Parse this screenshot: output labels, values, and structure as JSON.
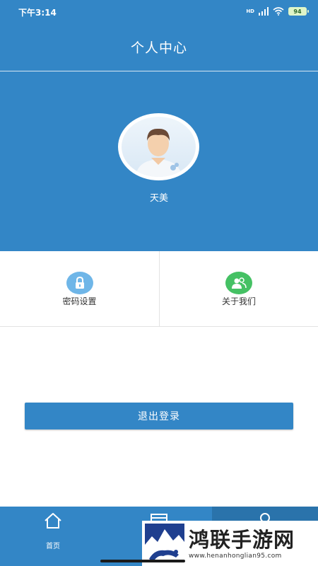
{
  "status_bar": {
    "time": "下午3:14",
    "network": "HD",
    "battery": "94"
  },
  "header": {
    "title": "个人中心"
  },
  "profile": {
    "username": "天美"
  },
  "menu": [
    {
      "label": "密码设置",
      "icon": "lock-icon",
      "color": "#6fb6e8"
    },
    {
      "label": "关于我们",
      "icon": "users-icon",
      "color": "#45c164"
    }
  ],
  "logout": {
    "label": "退出登录"
  },
  "tabbar": {
    "items": [
      {
        "label": "首页",
        "icon": "home-icon",
        "active": false
      },
      {
        "label": "",
        "icon": "calendar-icon",
        "active": false
      },
      {
        "label": "",
        "icon": "person-icon",
        "active": true
      }
    ]
  },
  "watermark": {
    "title": "鸿联手游网",
    "url": "www.henanhonglian95.com"
  },
  "colors": {
    "primary": "#3386c6",
    "active_tab": "#2a73ab",
    "menu_blue": "#6fb6e8",
    "menu_green": "#45c164"
  }
}
